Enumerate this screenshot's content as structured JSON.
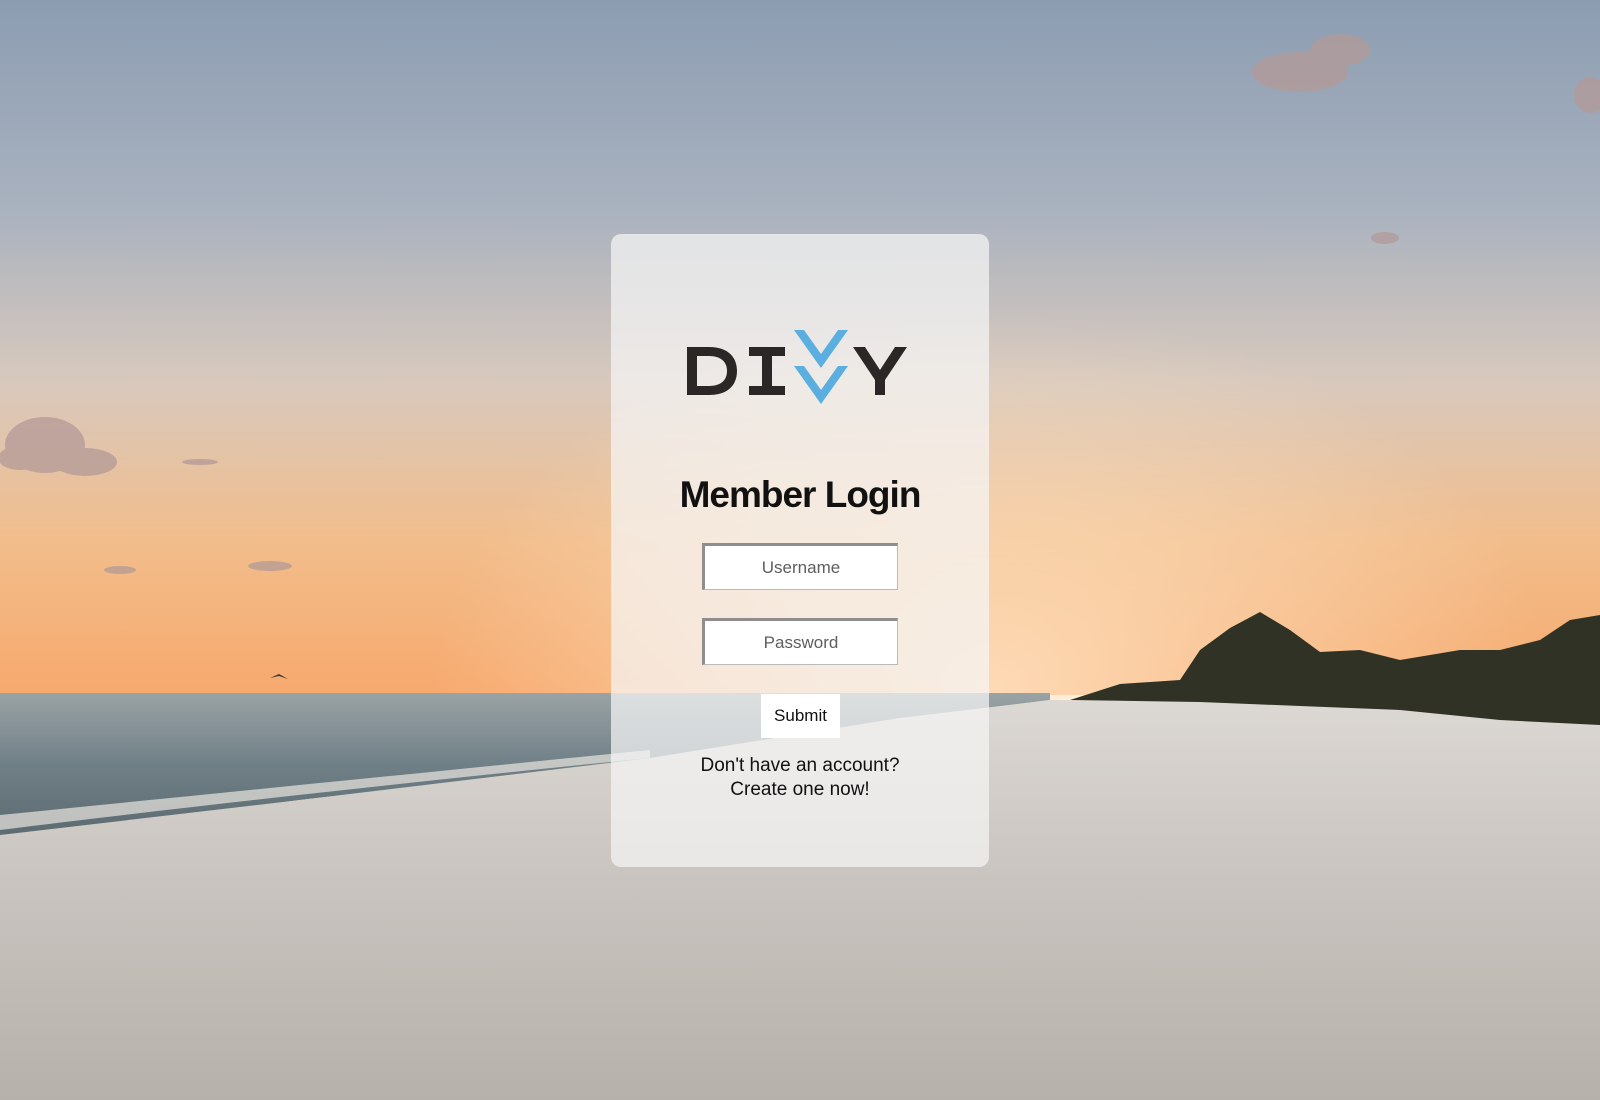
{
  "background": {
    "scene": "beach-sunset-photo",
    "sky_top_color": "#8c9db2",
    "horizon_color": "#f5b077",
    "sea_color": "#6f7f86",
    "sand_color": "#c9c4bf"
  },
  "login_card": {
    "logo_text": "DIVVY",
    "logo_dark_color": "#2b2726",
    "logo_accent_color": "#5aaee0",
    "title": "Member Login",
    "username_placeholder": "Username",
    "password_placeholder": "Password",
    "submit_label": "Submit",
    "signup_prompt": "Don't have an account?",
    "signup_link": "Create one now!"
  }
}
